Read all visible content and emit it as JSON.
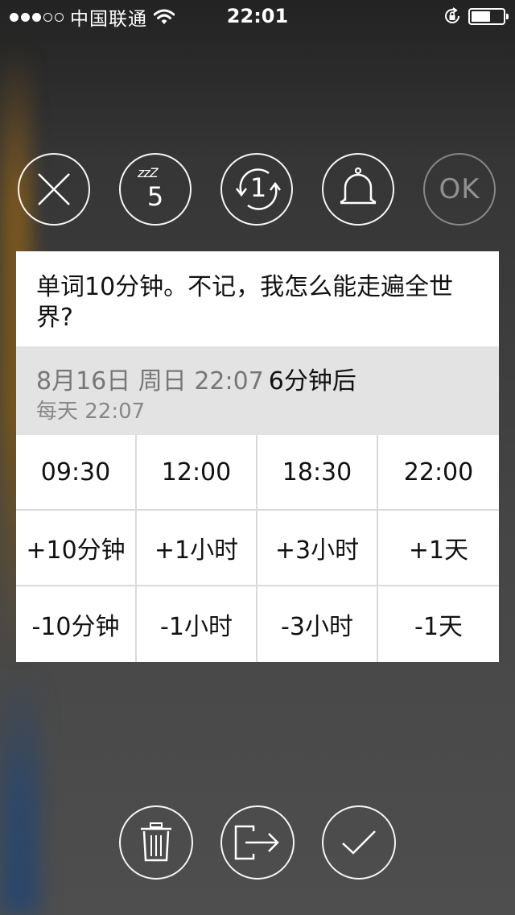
{
  "status_bar": {
    "carrier": "中国联通",
    "time": "22:01",
    "battery_level": 0.6
  },
  "actions": {
    "snooze_minutes": "5",
    "snooze_zzz": "zzZ",
    "repeat_count": "1",
    "ok_label": "OK"
  },
  "reminder": {
    "message": "单词10分钟。不记，我怎么能走遍全世界?",
    "datetime": "8月16日 周日 22:07",
    "relative": "6分钟后",
    "repeat": "每天 22:07"
  },
  "quick_options": {
    "row1": [
      "09:30",
      "12:00",
      "18:30",
      "22:00"
    ],
    "row2": [
      "+10分钟",
      "+1小时",
      "+3小时",
      "+1天"
    ],
    "row3": [
      "-10分钟",
      "-1小时",
      "-3小时",
      "-1天"
    ]
  },
  "icons": {
    "top": [
      "close-icon",
      "snooze-icon",
      "repeat-icon",
      "bell-icon",
      "ok-icon"
    ],
    "bottom": [
      "trash-icon",
      "exit-icon",
      "checkmark-icon"
    ]
  }
}
